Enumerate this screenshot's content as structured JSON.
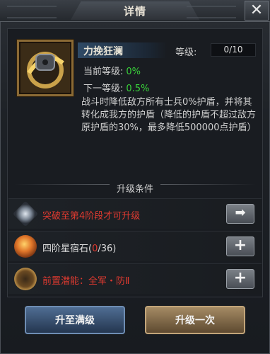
{
  "window": {
    "title": "详情",
    "close_label": "✕"
  },
  "skill": {
    "name": "力挽狂澜",
    "level_label": "等级:",
    "level_value": "0/10",
    "current_label": "当前等级:",
    "current_value": "0%",
    "next_label": "下一等级:",
    "next_value": "0.5%",
    "description": "战斗时降低敌方所有士兵0%护盾，并将其转化成我方的护盾（降低的护盾不超过敌方原护盾的30%，最多降低500000点护盾）"
  },
  "conditions": {
    "title": "升级条件",
    "rows": [
      {
        "text": "突破至第4阶段才可升级",
        "button": "➡",
        "icon": "crystal-icon"
      },
      {
        "text_prefix": "四阶星宿石(",
        "text_count": "0",
        "text_suffix": "/36)",
        "button": "+",
        "icon": "star-stone-icon"
      },
      {
        "text": "前置潜能：全军・防Ⅱ",
        "button": "+",
        "icon": "potential-badge-icon"
      }
    ]
  },
  "actions": {
    "max_label": "升至满级",
    "once_label": "升级一次"
  },
  "colors": {
    "green": "#39d23a",
    "red": "#e03a30"
  }
}
